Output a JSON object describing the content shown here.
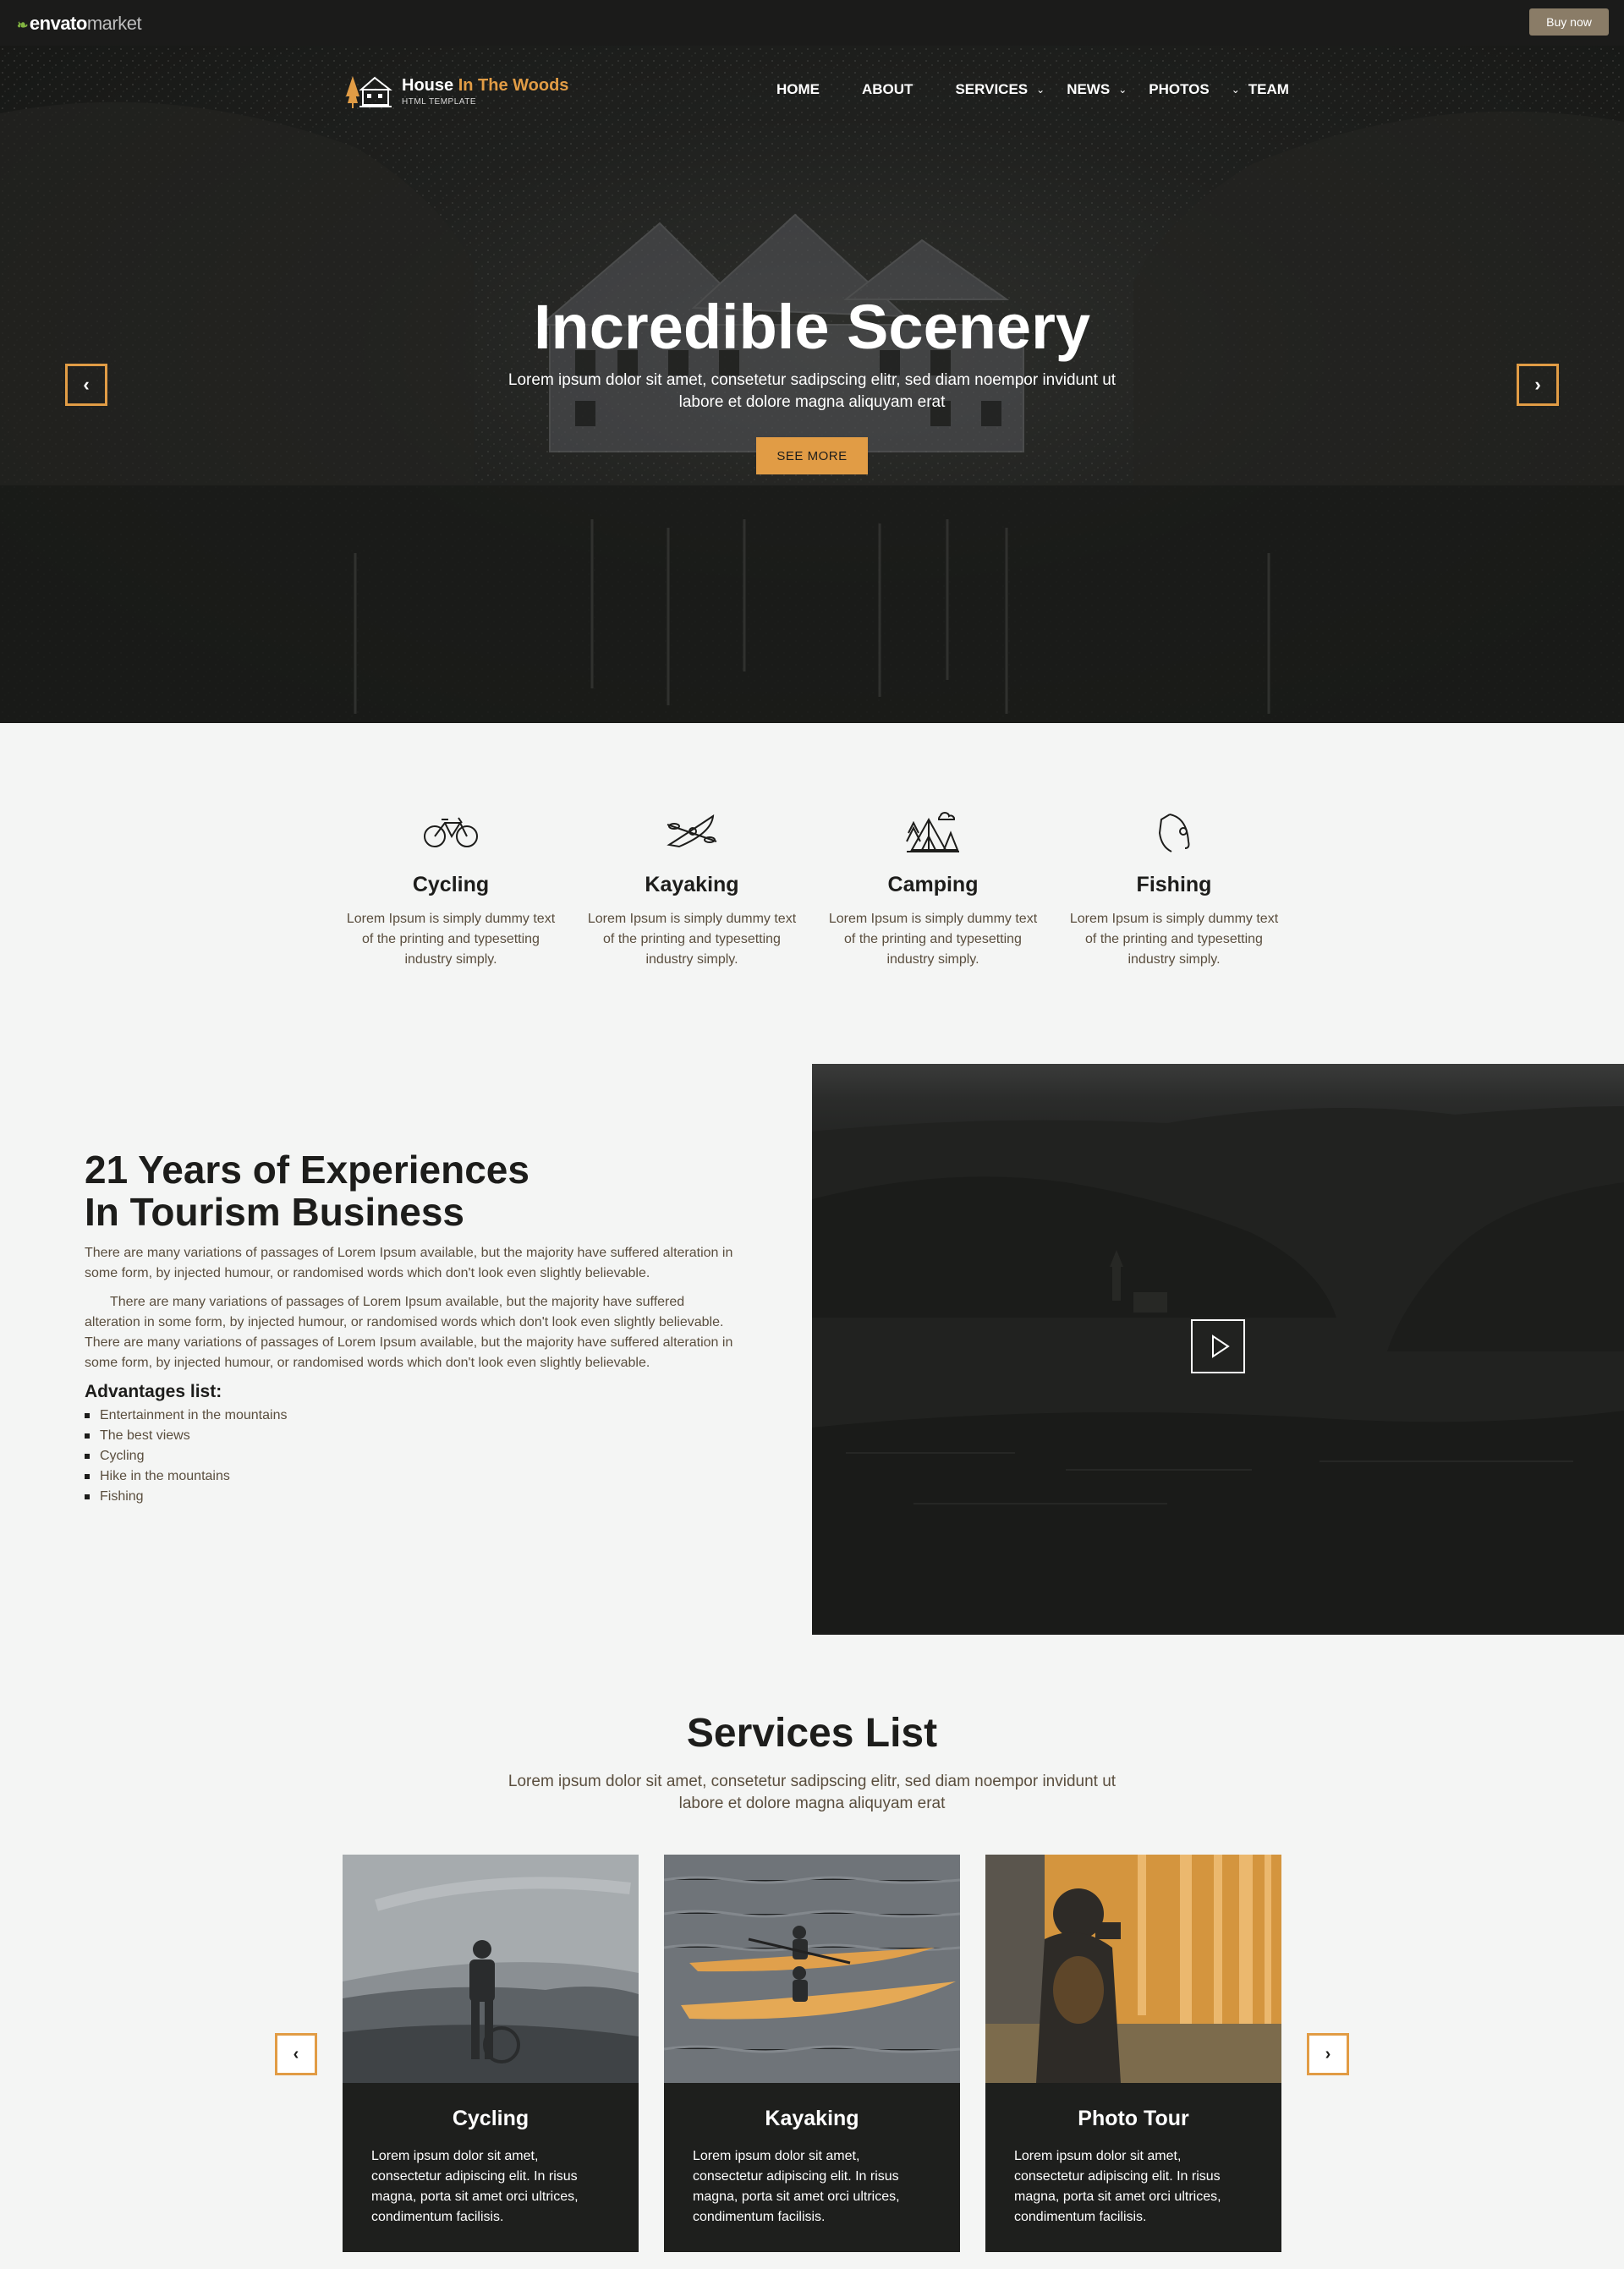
{
  "envato": {
    "brand": "envato",
    "brand_suffix": "market",
    "buy_label": "Buy now"
  },
  "header": {
    "brand_first": "House ",
    "brand_accent": "In The Woods",
    "brand_sub": "HTML TEMPLATE",
    "nav": {
      "home": "HOME",
      "about": "ABOUT",
      "services": "SERVICES",
      "news": "NEWS",
      "photos": "PHOTOS",
      "team": "TEAM",
      "chevron": "⌄"
    }
  },
  "hero": {
    "title": "Incredible Scenery",
    "subtitle": "Lorem ipsum dolor sit amet, consetetur sadipscing elitr, sed diam noempor invidunt ut labore et dolore magna aliquyam erat",
    "button": "SEE MORE",
    "prev": "‹",
    "next": "›"
  },
  "features": [
    {
      "icon": "bicycle-icon",
      "title": "Cycling",
      "text": "Lorem Ipsum is simply dummy text of the printing and typesetting industry simply."
    },
    {
      "icon": "kayak-icon",
      "title": "Kayaking",
      "text": "Lorem Ipsum is simply dummy text of the printing and typesetting industry simply."
    },
    {
      "icon": "camping-tent-icon",
      "title": "Camping",
      "text": "Lorem Ipsum is simply dummy text of the printing and typesetting industry simply."
    },
    {
      "icon": "fishing-rod-icon",
      "title": "Fishing",
      "text": "Lorem Ipsum is simply dummy text of the printing and typesetting industry simply."
    }
  ],
  "about": {
    "title_line1": "21 Years of Experiences",
    "title_line2": "In Tourism Business",
    "p1": "There are many variations of passages of Lorem Ipsum available, but the majority have suffered alteration in some form, by injected humour, or randomised words which don't look even slightly believable.",
    "p2": "There are many variations of passages of Lorem Ipsum available, but the majority have suffered alteration in some form, by injected humour, or randomised words which don't look even slightly believable. There are many variations of passages of Lorem Ipsum available, but the majority have suffered alteration in some form, by injected humour, or randomised words which don't look even slightly believable.",
    "list_title": "Advantages list:",
    "list": [
      "Entertainment in the mountains",
      "The best views",
      "Cycling",
      "Hike in the mountains",
      "Fishing"
    ]
  },
  "services": {
    "title": "Services List",
    "subtitle": "Lorem ipsum dolor sit amet, consetetur sadipscing elitr, sed diam noempor invidunt ut labore et dolore magna aliquyam erat",
    "prev": "‹",
    "next": "›",
    "cards": [
      {
        "title": "Cycling",
        "text": "Lorem ipsum dolor sit amet, consectetur adipiscing elit. In risus magna, porta sit amet orci ultrices, condimentum facilisis."
      },
      {
        "title": "Kayaking",
        "text": "Lorem ipsum dolor sit amet, consectetur adipiscing elit. In risus magna, porta sit amet orci ultrices, condimentum facilisis."
      },
      {
        "title": "Photo Tour",
        "text": "Lorem ipsum dolor sit amet, consectetur adipiscing elit. In risus magna, porta sit amet orci ultrices, condimentum facilisis."
      }
    ]
  },
  "colors": {
    "accent": "#e19c45",
    "dark": "#1d1d1b",
    "text": "#5a4e3e",
    "background": "#f4f5f4",
    "buy_button": "#8a7c67"
  }
}
